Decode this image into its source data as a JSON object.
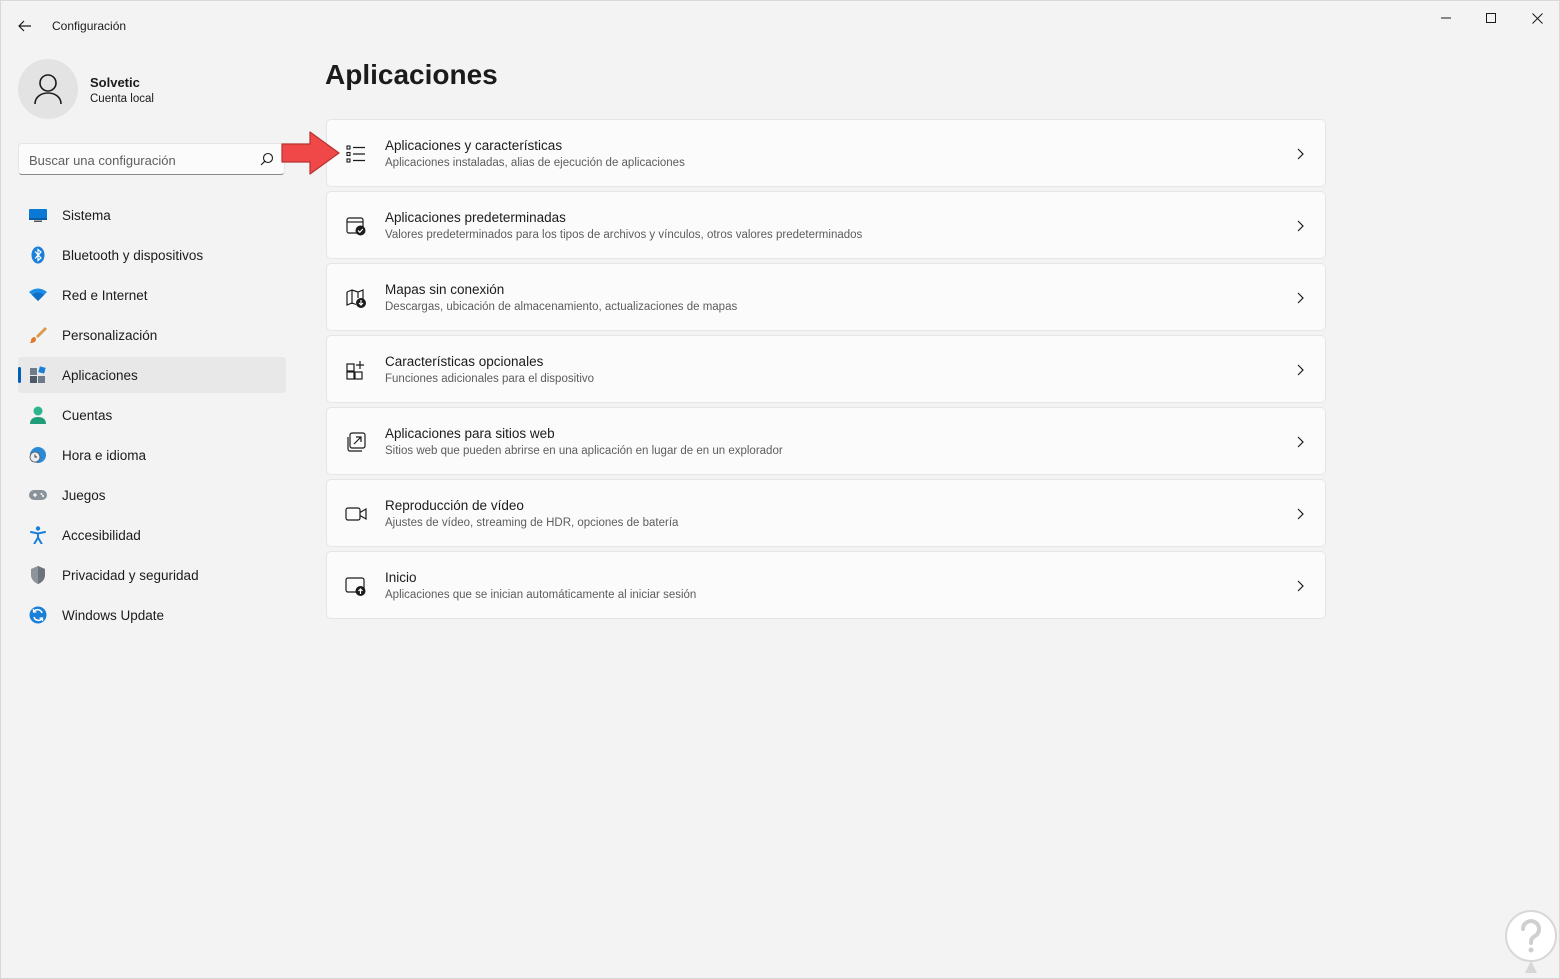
{
  "titlebar": {
    "back_icon": "back-arrow-icon",
    "title": "Configuración",
    "minimize_icon": "minimize-icon",
    "maximize_icon": "maximize-icon",
    "close_icon": "close-icon"
  },
  "profile": {
    "name": "Solvetic",
    "account": "Cuenta local"
  },
  "search": {
    "placeholder": "Buscar una configuración",
    "value": ""
  },
  "nav": {
    "items": [
      {
        "label": "Sistema",
        "icon": "monitor-icon"
      },
      {
        "label": "Bluetooth y dispositivos",
        "icon": "bluetooth-icon"
      },
      {
        "label": "Red e Internet",
        "icon": "wifi-icon"
      },
      {
        "label": "Personalización",
        "icon": "brush-icon"
      },
      {
        "label": "Aplicaciones",
        "icon": "apps-icon",
        "active": true
      },
      {
        "label": "Cuentas",
        "icon": "person-icon"
      },
      {
        "label": "Hora e idioma",
        "icon": "clock-globe-icon"
      },
      {
        "label": "Juegos",
        "icon": "gamepad-icon"
      },
      {
        "label": "Accesibilidad",
        "icon": "accessibility-icon"
      },
      {
        "label": "Privacidad y seguridad",
        "icon": "shield-icon"
      },
      {
        "label": "Windows Update",
        "icon": "update-icon"
      }
    ]
  },
  "main": {
    "title": "Aplicaciones",
    "cards": [
      {
        "title": "Aplicaciones y características",
        "subtitle": "Aplicaciones instaladas, alias de ejecución de aplicaciones",
        "icon": "list-icon"
      },
      {
        "title": "Aplicaciones predeterminadas",
        "subtitle": "Valores predeterminados para los tipos de archivos y vínculos, otros valores predeterminados",
        "icon": "default-apps-icon"
      },
      {
        "title": "Mapas sin conexión",
        "subtitle": "Descargas, ubicación de almacenamiento, actualizaciones de mapas",
        "icon": "map-download-icon"
      },
      {
        "title": "Características opcionales",
        "subtitle": "Funciones adicionales para el dispositivo",
        "icon": "add-grid-icon"
      },
      {
        "title": "Aplicaciones para sitios web",
        "subtitle": "Sitios web que pueden abrirse en una aplicación en lugar de en un explorador",
        "icon": "open-in-app-icon"
      },
      {
        "title": "Reproducción de vídeo",
        "subtitle": "Ajustes de vídeo, streaming de HDR, opciones de batería",
        "icon": "video-icon"
      },
      {
        "title": "Inicio",
        "subtitle": "Aplicaciones que se inician automáticamente al iniciar sesión",
        "icon": "startup-icon"
      }
    ]
  },
  "colors": {
    "accent": "#005fb8",
    "annotation_arrow": "#f04848",
    "background": "#f3f3f3",
    "card": "#fbfbfb"
  }
}
